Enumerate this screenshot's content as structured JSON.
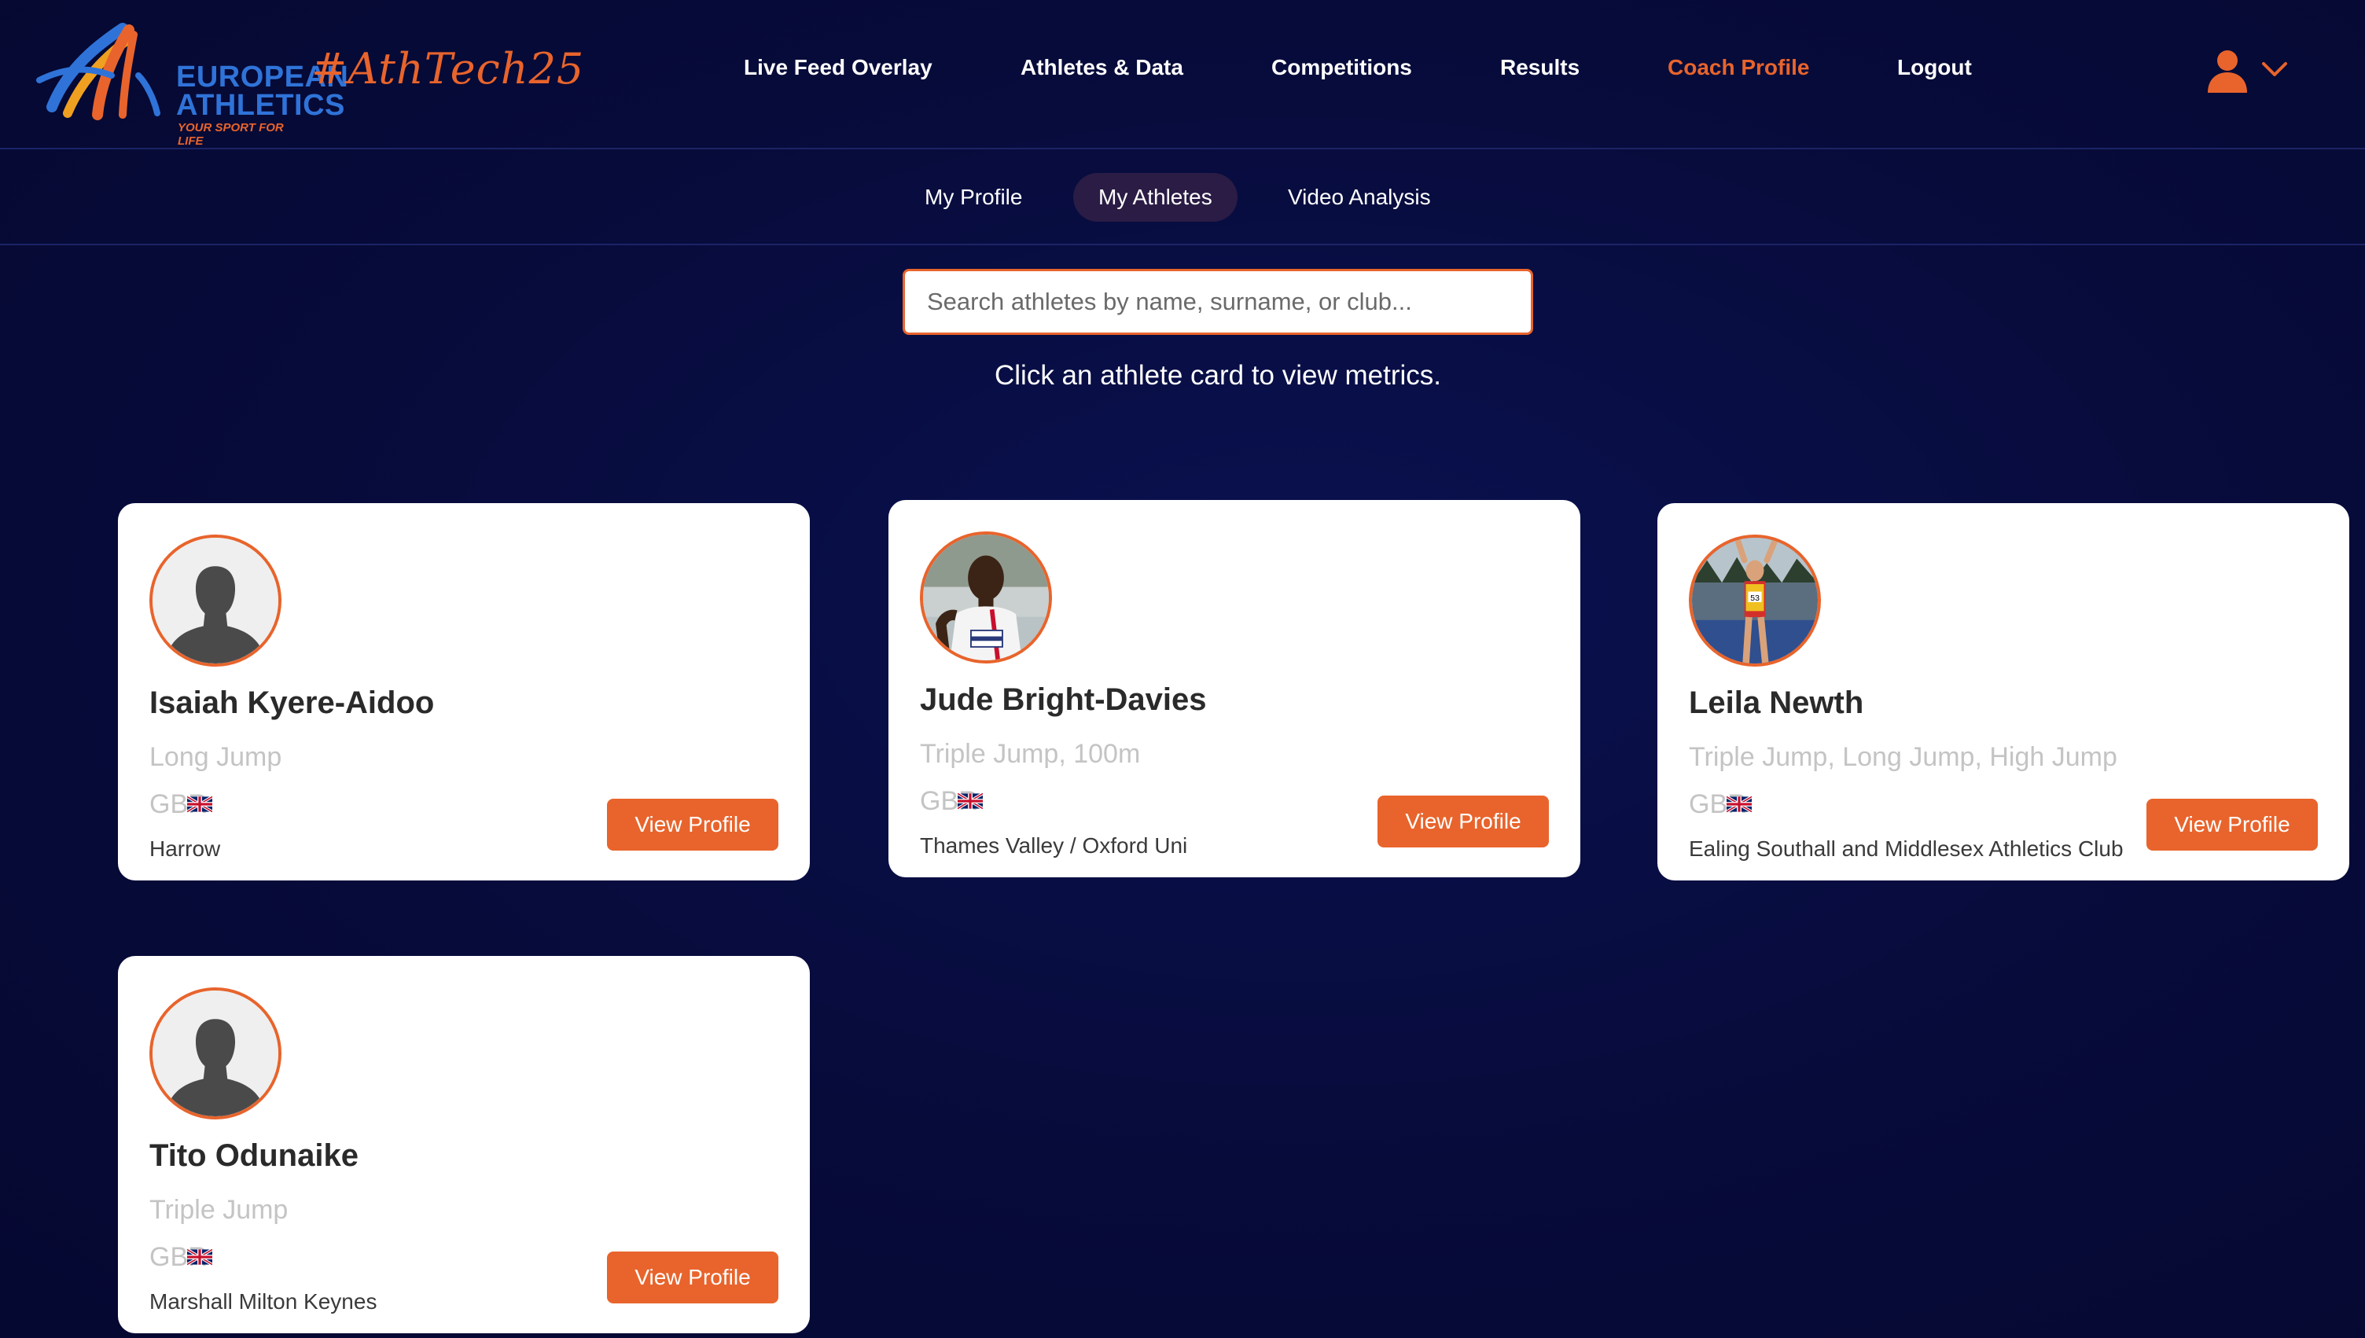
{
  "brand": {
    "logo_line1": "EUROPEAN",
    "logo_line2": "ATHLETICS",
    "logo_tagline": "YOUR SPORT FOR LIFE",
    "hashtag": "#AthTech25"
  },
  "nav": {
    "items": [
      {
        "label": "Live Feed Overlay"
      },
      {
        "label": "Athletes & Data"
      },
      {
        "label": "Competitions"
      },
      {
        "label": "Results"
      },
      {
        "label": "Coach Profile",
        "active": true
      },
      {
        "label": "Logout"
      }
    ],
    "user_icon": "user-icon",
    "dropdown_icon": "chevron-down-icon"
  },
  "subnav": {
    "tabs": [
      {
        "label": "My Profile"
      },
      {
        "label": "My Athletes",
        "active": true
      },
      {
        "label": "Video Analysis"
      }
    ]
  },
  "search": {
    "placeholder": "Search athletes by name, surname, or club...",
    "value": ""
  },
  "hint": "Click an athlete card to view metrics.",
  "athletes": [
    {
      "name": "Isaiah Kyere-Aidoo",
      "events": "Long Jump",
      "country": "GBR",
      "club": "Harrow",
      "button": "View Profile",
      "avatar": "placeholder-silhouette"
    },
    {
      "name": "Jude Bright-Davies",
      "events": "Triple Jump, 100m",
      "country": "GBR",
      "club": "Thames Valley / Oxford Uni",
      "button": "View Profile",
      "avatar": "photo"
    },
    {
      "name": "Leila Newth",
      "events": "Triple Jump, Long Jump, High Jump",
      "country": "GBR",
      "club": "Ealing Southall and Middlesex Athletics Club",
      "button": "View Profile",
      "avatar": "photo"
    },
    {
      "name": "Tito Odunaike",
      "events": "Triple Jump",
      "country": "GBR",
      "club": "Marshall Milton Keynes",
      "button": "View Profile",
      "avatar": "placeholder-silhouette"
    }
  ],
  "colors": {
    "background": "#070b3a",
    "accent": "#e8642c",
    "logo_blue": "#2f73d8",
    "card": "#ffffff",
    "active_tab": "#2a1c44"
  }
}
